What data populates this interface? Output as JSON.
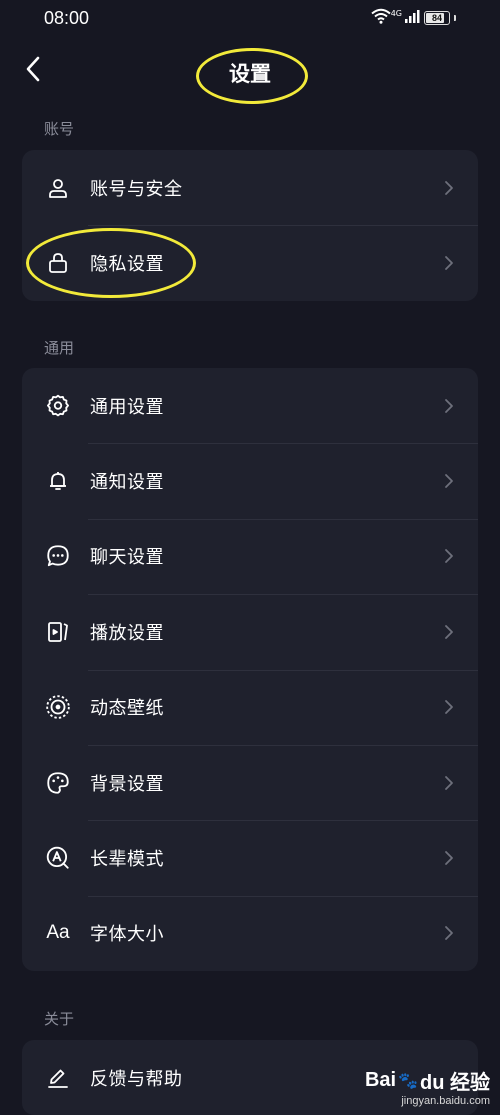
{
  "status_bar": {
    "time": "08:00",
    "network": "4G",
    "battery": "84",
    "battery_level": 0.84,
    "icons": [
      "wifi-icon",
      "signal-icon",
      "battery-icon"
    ]
  },
  "header": {
    "title": "设置",
    "back_icon": "chevron-left-icon"
  },
  "sections": [
    {
      "label": "账号",
      "items": [
        {
          "label": "账号与安全",
          "icon": "user-icon"
        },
        {
          "label": "隐私设置",
          "icon": "lock-icon"
        }
      ]
    },
    {
      "label": "通用",
      "items": [
        {
          "label": "通用设置",
          "icon": "gear-icon"
        },
        {
          "label": "通知设置",
          "icon": "bell-icon"
        },
        {
          "label": "聊天设置",
          "icon": "chat-bubble-icon"
        },
        {
          "label": "播放设置",
          "icon": "play-panel-icon"
        },
        {
          "label": "动态壁纸",
          "icon": "dynamic-wallpaper-icon"
        },
        {
          "label": "背景设置",
          "icon": "palette-icon"
        },
        {
          "label": "长辈模式",
          "icon": "elder-mode-icon"
        },
        {
          "label": "字体大小",
          "icon": "font-size-icon",
          "icon_text": "Aa"
        }
      ]
    },
    {
      "label": "关于",
      "items": [
        {
          "label": "反馈与帮助",
          "icon": "pencil-icon"
        }
      ]
    }
  ],
  "annotations": {
    "highlight_color": "#f2ea3a"
  },
  "watermark": {
    "logo": "Bai du 经验",
    "logo_left": "Bai",
    "logo_right": "du 经验",
    "url": "jingyan.baidu.com"
  },
  "colors": {
    "background": "#161722",
    "card": "#1f212d",
    "text": "#ffffff",
    "secondary_text": "#8a8c99",
    "divider": "#2e303d"
  }
}
